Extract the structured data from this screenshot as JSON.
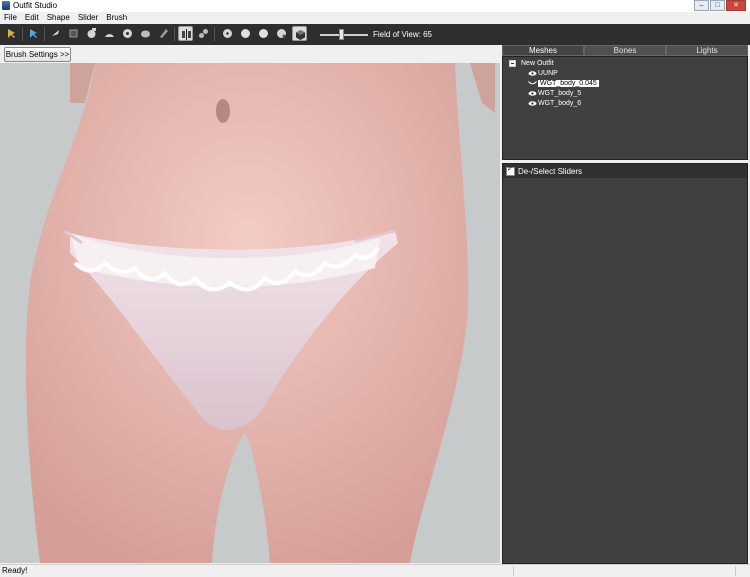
{
  "window": {
    "title": "Outfit Studio"
  },
  "menu": [
    "File",
    "Edit",
    "Shape",
    "Slider",
    "Brush"
  ],
  "toolbar": {
    "fov_label": "Field of View: 65",
    "fov_value": 65
  },
  "viewport": {
    "brush_settings_label": "Brush Settings >>"
  },
  "right_panel": {
    "tabs": [
      "Meshes",
      "Bones",
      "Lights"
    ],
    "active_tab": "Meshes",
    "tree_root": "New Outfit",
    "meshes": [
      {
        "label": "UUNP",
        "selected": false
      },
      {
        "label": "WGT_body_0.045",
        "selected": true
      },
      {
        "label": "WGT_body_5",
        "selected": false
      },
      {
        "label": "WGT_body_6",
        "selected": false
      }
    ],
    "sliders_header": "De-/Select Sliders"
  },
  "status": {
    "text": "Ready!"
  },
  "colors": {
    "toolbar_bg": "#2e2e2e",
    "panel_bg": "#404040",
    "viewport_bg": "#c6cacb"
  },
  "icons": [
    "select-brush-icon",
    "mask-brush-icon",
    "undo-icon",
    "redo-icon",
    "move-tool-icon",
    "inflate-brush-icon",
    "deflate-brush-icon",
    "smooth-brush-icon",
    "weight-brush-icon",
    "color-brush-icon",
    "mirror-x-icon",
    "mirror-connected-icon",
    "shade-point-icon",
    "shade-smooth-icon",
    "shade-flat-icon",
    "shade-wire-icon",
    "texture-toggle-icon"
  ]
}
